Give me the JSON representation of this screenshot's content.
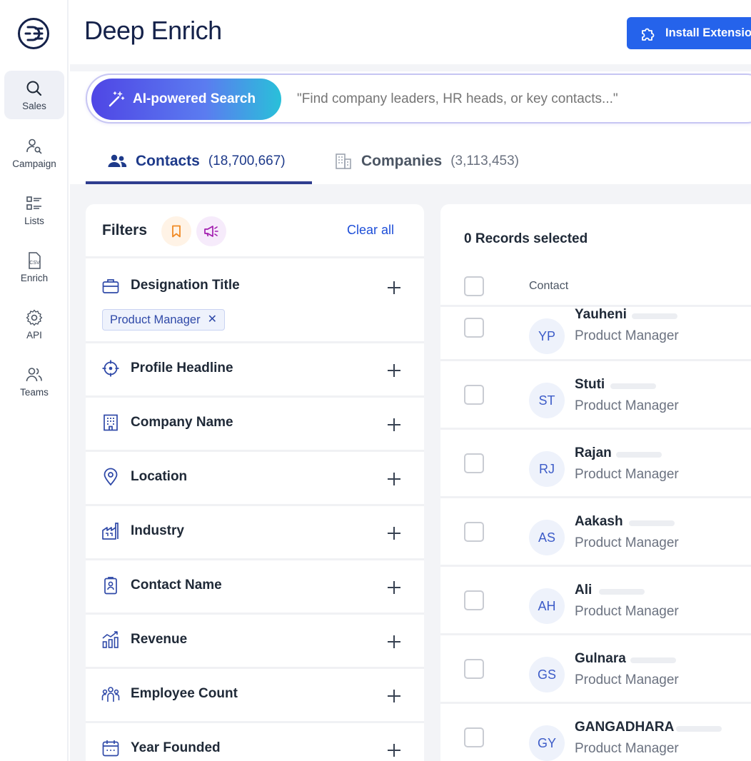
{
  "app": {
    "title": "Deep Enrich",
    "install_button": "Install Extension"
  },
  "rail": [
    {
      "label": "Sales",
      "icon": "search-icon",
      "active": true
    },
    {
      "label": "Campaign",
      "icon": "user-search-icon"
    },
    {
      "label": "Lists",
      "icon": "list-icon"
    },
    {
      "label": "Enrich",
      "icon": "csv-file-icon"
    },
    {
      "label": "API",
      "icon": "gear-icon"
    },
    {
      "label": "Teams",
      "icon": "users-icon"
    }
  ],
  "search": {
    "button": "AI-powered Search",
    "placeholder": "\"Find company leaders, HR heads, or key contacts...\""
  },
  "tabs": [
    {
      "label": "Contacts",
      "count": "(18,700,667)",
      "active": true
    },
    {
      "label": "Companies",
      "count": "(3,113,453)"
    }
  ],
  "filters": {
    "title": "Filters",
    "clear_all": "Clear all",
    "items": [
      {
        "label": "Designation Title",
        "icon": "briefcase-icon",
        "chip": "Product Manager"
      },
      {
        "label": "Profile Headline",
        "icon": "crosshair-icon"
      },
      {
        "label": "Company Name",
        "icon": "building-icon"
      },
      {
        "label": "Location",
        "icon": "location-pin-icon"
      },
      {
        "label": "Industry",
        "icon": "factory-icon"
      },
      {
        "label": "Contact Name",
        "icon": "id-badge-icon"
      },
      {
        "label": "Revenue",
        "icon": "chart-up-icon"
      },
      {
        "label": "Employee Count",
        "icon": "people-group-icon"
      },
      {
        "label": "Year Founded",
        "icon": "calendar-icon"
      }
    ]
  },
  "results": {
    "records_selected": "0 Records selected",
    "column_contact": "Contact",
    "rows": [
      {
        "initials": "YP",
        "name": "Yauheni",
        "title": "Product Manager"
      },
      {
        "initials": "ST",
        "name": "Stuti",
        "title": "Product Manager"
      },
      {
        "initials": "RJ",
        "name": "Rajan",
        "title": "Product Manager"
      },
      {
        "initials": "AS",
        "name": "Aakash",
        "title": "Product Manager"
      },
      {
        "initials": "AH",
        "name": "Ali",
        "title": "Product Manager"
      },
      {
        "initials": "GS",
        "name": "Gulnara",
        "title": "Product Manager"
      },
      {
        "initials": "GY",
        "name": "GANGADHARA",
        "title": "Product Manager"
      }
    ]
  },
  "colors": {
    "brand_navy": "#15224a",
    "primary_blue": "#2563eb",
    "tab_active": "#1e3a8a",
    "ai_gradient_start": "#4f46e5",
    "ai_gradient_end": "#29c0d9"
  }
}
